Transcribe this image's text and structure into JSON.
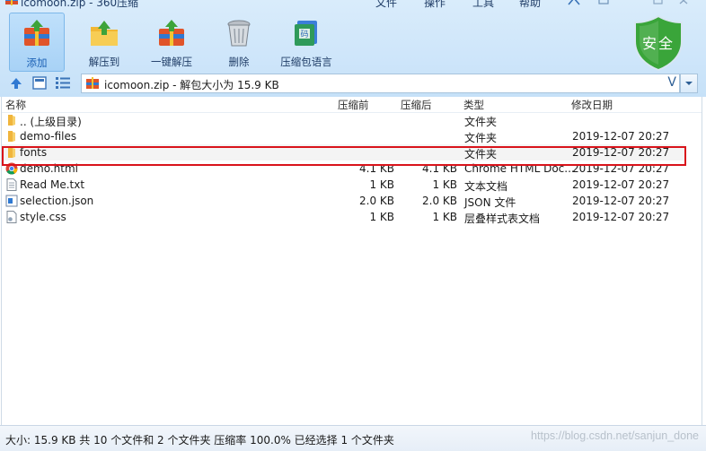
{
  "window": {
    "title": "icomoon.zip - 360压缩"
  },
  "menu": [
    "文件",
    "操作",
    "工具",
    "帮助"
  ],
  "toolbar": [
    {
      "label": "添加",
      "icon": "add-archive-icon"
    },
    {
      "label": "解压到",
      "icon": "extract-to-icon"
    },
    {
      "label": "一键解压",
      "icon": "one-click-extract-icon"
    },
    {
      "label": "删除",
      "icon": "trash-icon"
    },
    {
      "label": "压缩包语言",
      "icon": "archive-language-icon"
    }
  ],
  "security": {
    "label": "安全",
    "color": "#2f9a32"
  },
  "address": {
    "text": "icomoon.zip - 解包大小为 15.9 KB",
    "v": "V"
  },
  "columns": {
    "name": "名称",
    "before": "压缩前",
    "after": "压缩后",
    "type": "类型",
    "date": "修改日期"
  },
  "files": [
    {
      "name": ".. (上级目录)",
      "before": "",
      "after": "",
      "type": "文件夹",
      "date": "",
      "icon": "folder-icon"
    },
    {
      "name": "demo-files",
      "before": "",
      "after": "",
      "type": "文件夹",
      "date": "2019-12-07 20:27",
      "icon": "folder-icon"
    },
    {
      "name": "fonts",
      "before": "",
      "after": "",
      "type": "文件夹",
      "date": "2019-12-07 20:27",
      "icon": "folder-icon"
    },
    {
      "name": "demo.html",
      "before": "4.1 KB",
      "after": "4.1 KB",
      "type": "Chrome HTML Doc...",
      "date": "2019-12-07 20:27",
      "icon": "chrome-icon"
    },
    {
      "name": "Read Me.txt",
      "before": "1 KB",
      "after": "1 KB",
      "type": "文本文档",
      "date": "2019-12-07 20:27",
      "icon": "text-file-icon"
    },
    {
      "name": "selection.json",
      "before": "2.0 KB",
      "after": "2.0 KB",
      "type": "JSON 文件",
      "date": "2019-12-07 20:27",
      "icon": "json-file-icon"
    },
    {
      "name": "style.css",
      "before": "1 KB",
      "after": "1 KB",
      "type": "层叠样式表文档",
      "date": "2019-12-07 20:27",
      "icon": "css-file-icon"
    }
  ],
  "status": {
    "text": "大小: 15.9 KB 共 10 个文件和 2 个文件夹 压缩率 100.0% 已经选择 1 个文件夹"
  },
  "watermark": "https://blog.csdn.net/sanjun_done",
  "highlight_color": "#d9131b"
}
